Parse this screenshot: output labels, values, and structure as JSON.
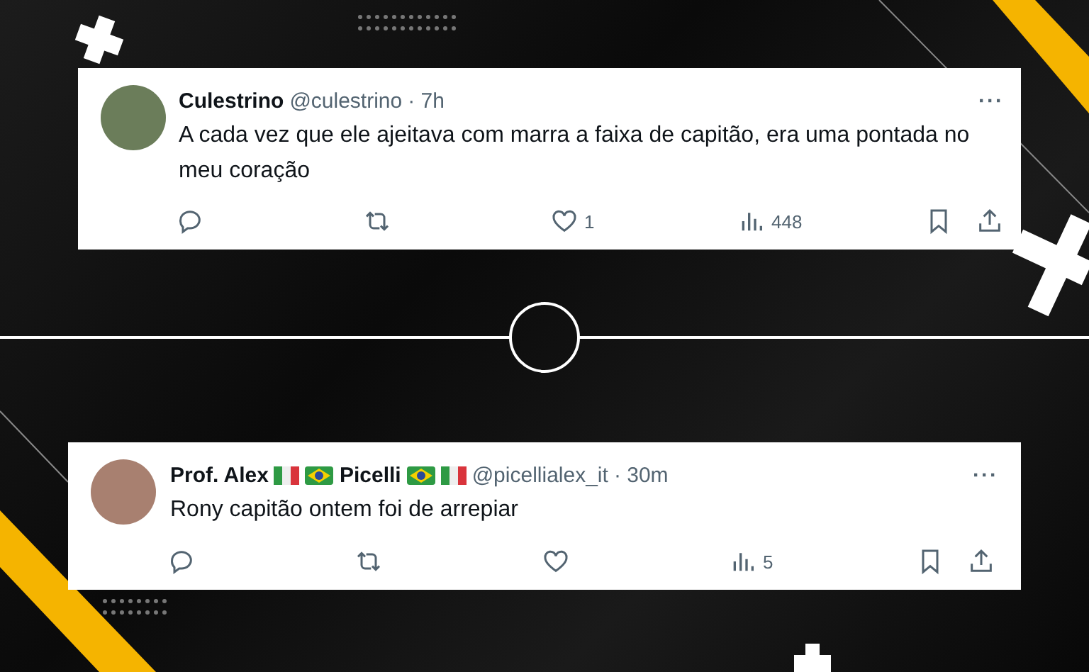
{
  "tweets": [
    {
      "name_parts": [
        {
          "kind": "text",
          "text": "Culestrino"
        }
      ],
      "handle": "@culestrino",
      "time": "· 7h",
      "text": "A cada vez que ele ajeitava com marra a faixa de capitão, era uma pontada no meu coração",
      "more": "···",
      "likes": "1",
      "views": "448"
    },
    {
      "name_parts": [
        {
          "kind": "text",
          "text": "Prof. Alex"
        },
        {
          "kind": "italy-flag"
        },
        {
          "kind": "brazil-flag"
        },
        {
          "kind": "text",
          "text": "Picelli"
        },
        {
          "kind": "brazil-flag"
        },
        {
          "kind": "italy-flag"
        }
      ],
      "handle": "@picellialex_it",
      "time": "· 30m",
      "text": "Rony capitão ontem foi de arrepiar",
      "more": "···",
      "views": "5"
    }
  ]
}
